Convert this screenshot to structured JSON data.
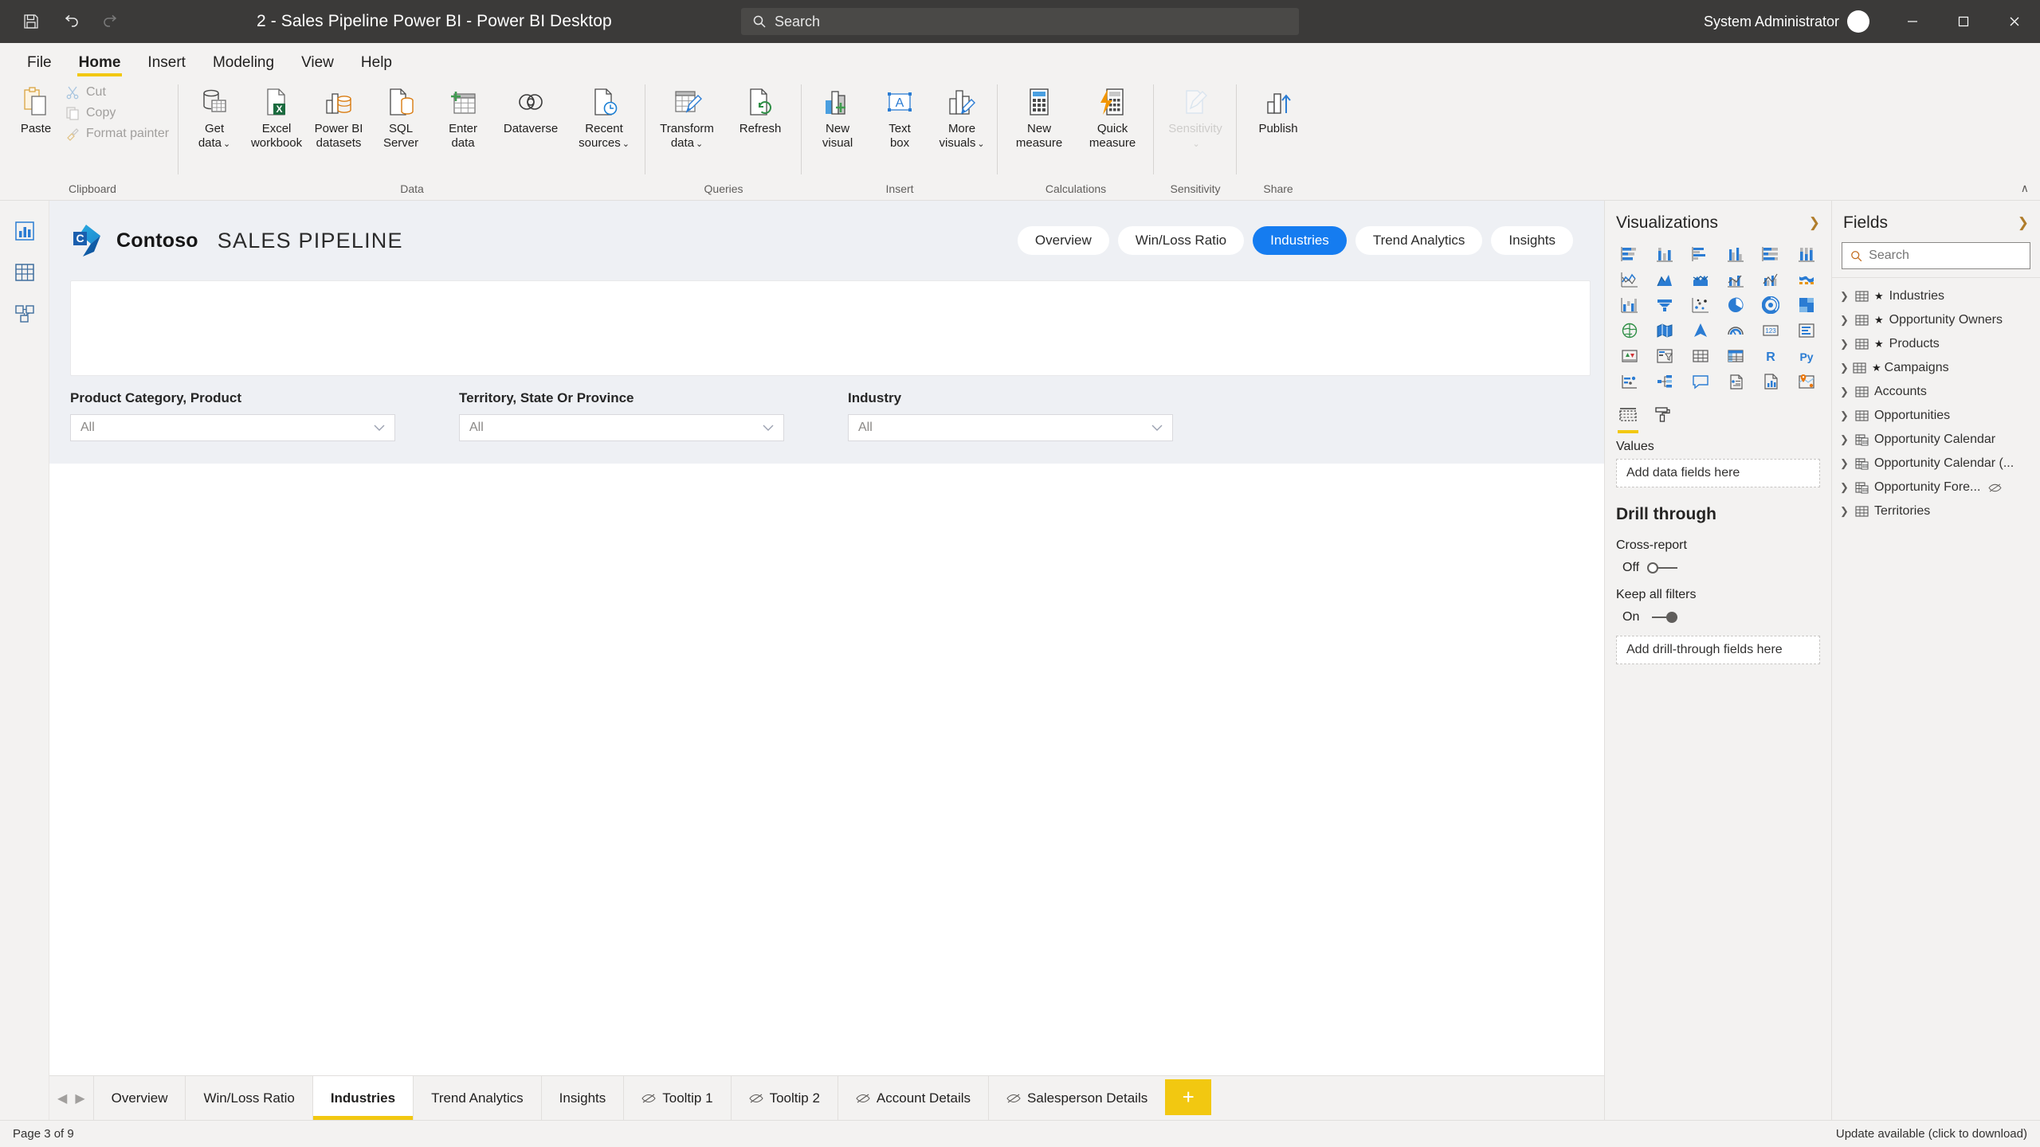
{
  "titlebar": {
    "document_title": "2 - Sales Pipeline Power BI - Power BI Desktop",
    "search_placeholder": "Search",
    "user": "System Administrator",
    "save_icon": "save-icon",
    "undo_icon": "undo-icon",
    "redo_icon": "redo-icon",
    "minimize_icon": "minimize-icon",
    "maximize_icon": "maximize-icon",
    "close_icon": "close-icon"
  },
  "ribbon": {
    "tabs": [
      {
        "label": "File",
        "active": false
      },
      {
        "label": "Home",
        "active": true
      },
      {
        "label": "Insert",
        "active": false
      },
      {
        "label": "Modeling",
        "active": false
      },
      {
        "label": "View",
        "active": false
      },
      {
        "label": "Help",
        "active": false
      }
    ],
    "groups": [
      {
        "name": "Clipboard",
        "paste_label": "Paste",
        "small_items": [
          {
            "label": "Cut",
            "icon": "scissors-icon"
          },
          {
            "label": "Copy",
            "icon": "copy-icon"
          },
          {
            "label": "Format painter",
            "icon": "paintbrush-icon"
          }
        ]
      },
      {
        "name": "Data",
        "buttons": [
          {
            "label_1": "Get",
            "label_2": "data",
            "dropdown": true,
            "icon": "database-table-icon"
          },
          {
            "label_1": "Excel",
            "label_2": "workbook",
            "dropdown": false,
            "icon": "excel-icon"
          },
          {
            "label_1": "Power BI",
            "label_2": "datasets",
            "dropdown": false,
            "icon": "powerbi-dataset-icon"
          },
          {
            "label_1": "SQL",
            "label_2": "Server",
            "dropdown": false,
            "icon": "sql-server-icon"
          },
          {
            "label_1": "Enter",
            "label_2": "data",
            "dropdown": false,
            "icon": "enter-data-icon"
          },
          {
            "label_1": "Dataverse",
            "label_2": "",
            "dropdown": false,
            "icon": "dataverse-icon"
          },
          {
            "label_1": "Recent",
            "label_2": "sources",
            "dropdown": true,
            "icon": "recent-sources-icon"
          }
        ]
      },
      {
        "name": "Queries",
        "buttons": [
          {
            "label_1": "Transform",
            "label_2": "data",
            "dropdown": true,
            "icon": "transform-data-icon"
          },
          {
            "label_1": "Refresh",
            "label_2": "",
            "dropdown": false,
            "icon": "refresh-icon"
          }
        ]
      },
      {
        "name": "Insert",
        "buttons": [
          {
            "label_1": "New",
            "label_2": "visual",
            "dropdown": false,
            "icon": "new-visual-icon"
          },
          {
            "label_1": "Text",
            "label_2": "box",
            "dropdown": false,
            "icon": "text-box-icon"
          },
          {
            "label_1": "More",
            "label_2": "visuals",
            "dropdown": true,
            "icon": "more-visuals-icon"
          }
        ]
      },
      {
        "name": "Calculations",
        "buttons": [
          {
            "label_1": "New",
            "label_2": "measure",
            "dropdown": false,
            "icon": "new-measure-icon"
          },
          {
            "label_1": "Quick",
            "label_2": "measure",
            "dropdown": false,
            "icon": "quick-measure-icon"
          }
        ]
      },
      {
        "name": "Sensitivity",
        "buttons": [
          {
            "label_1": "Sensitivity",
            "label_2": "",
            "dropdown": true,
            "icon": "sensitivity-icon",
            "disabled": true
          }
        ]
      },
      {
        "name": "Share",
        "buttons": [
          {
            "label_1": "Publish",
            "label_2": "",
            "dropdown": false,
            "icon": "publish-icon"
          }
        ]
      }
    ],
    "collapse_label": "∧"
  },
  "view_rail": [
    {
      "name": "report-view",
      "icon": "report-chart-icon",
      "active": true
    },
    {
      "name": "data-view",
      "icon": "data-table-icon",
      "active": false
    },
    {
      "name": "model-view",
      "icon": "model-relationship-icon",
      "active": false
    }
  ],
  "report": {
    "brand": "Contoso",
    "subtitle": "SALES PIPELINE",
    "logo_letter": "C",
    "nav_pills": [
      {
        "label": "Overview",
        "active": false
      },
      {
        "label": "Win/Loss Ratio",
        "active": false
      },
      {
        "label": "Industries",
        "active": true
      },
      {
        "label": "Trend Analytics",
        "active": false
      },
      {
        "label": "Insights",
        "active": false
      }
    ],
    "accent_color": "#157cf0",
    "slicers": [
      {
        "title": "Product Category, Product",
        "value": "All"
      },
      {
        "title": "Territory, State Or Province",
        "value": "All"
      },
      {
        "title": "Industry",
        "value": "All"
      }
    ]
  },
  "page_tabs": {
    "prev_icon": "chevron-left-icon",
    "next_icon": "chevron-right-icon",
    "items": [
      {
        "label": "Overview",
        "active": false,
        "hidden": false
      },
      {
        "label": "Win/Loss Ratio",
        "active": false,
        "hidden": false
      },
      {
        "label": "Industries",
        "active": true,
        "hidden": false
      },
      {
        "label": "Trend Analytics",
        "active": false,
        "hidden": false
      },
      {
        "label": "Insights",
        "active": false,
        "hidden": false
      },
      {
        "label": "Tooltip 1",
        "active": false,
        "hidden": true
      },
      {
        "label": "Tooltip 2",
        "active": false,
        "hidden": true
      },
      {
        "label": "Account Details",
        "active": false,
        "hidden": true
      },
      {
        "label": "Salesperson Details",
        "active": false,
        "hidden": true
      }
    ],
    "add_label": "+"
  },
  "visualizations": {
    "title": "Visualizations",
    "expand_icon": "chevron-right-icon",
    "icons": [
      "stacked-bar-chart-icon",
      "stacked-column-chart-icon",
      "clustered-bar-chart-icon",
      "clustered-column-chart-icon",
      "100-stacked-bar-chart-icon",
      "100-stacked-column-chart-icon",
      "line-chart-icon",
      "area-chart-icon",
      "stacked-area-chart-icon",
      "line-stacked-column-chart-icon",
      "line-clustered-column-chart-icon",
      "ribbon-chart-icon",
      "waterfall-chart-icon",
      "funnel-chart-icon",
      "scatter-chart-icon",
      "pie-chart-icon",
      "donut-chart-icon",
      "treemap-icon",
      "map-icon",
      "filled-map-icon",
      "azure-map-icon",
      "gauge-icon",
      "card-icon",
      "multi-row-card-icon",
      "kpi-icon",
      "slicer-icon",
      "table-icon",
      "matrix-icon",
      "r-script-visual-icon",
      "python-visual-icon",
      "key-influencers-icon",
      "decomposition-tree-icon",
      "qna-icon",
      "smart-narrative-icon",
      "paginated-report-icon",
      "arcgis-map-icon"
    ],
    "panel_tabs": [
      {
        "name": "fields-tab",
        "icon": "fields-well-icon",
        "active": true
      },
      {
        "name": "format-tab",
        "icon": "paint-roller-icon",
        "active": false
      }
    ],
    "values_label": "Values",
    "values_placeholder": "Add data fields here",
    "drill_through": {
      "title": "Drill through",
      "cross_report_label": "Cross-report",
      "cross_report_state": "Off",
      "keep_filters_label": "Keep all filters",
      "keep_filters_state": "On",
      "placeholder": "Add drill-through fields here"
    }
  },
  "fields": {
    "title": "Fields",
    "expand_icon": "chevron-right-icon",
    "search_placeholder": "Search",
    "search_icon": "search-icon",
    "items": [
      {
        "label": "Industries",
        "starred": true,
        "icon": "table-icon",
        "hidden": false
      },
      {
        "label": "Opportunity Owners",
        "starred": true,
        "icon": "table-icon",
        "hidden": false
      },
      {
        "label": "Products",
        "starred": true,
        "icon": "table-icon",
        "hidden": false
      },
      {
        "label": "Campaigns",
        "starred": true,
        "icon": "table-icon",
        "hidden": false,
        "tight": true
      },
      {
        "label": "Accounts",
        "starred": false,
        "icon": "table-icon",
        "hidden": false
      },
      {
        "label": "Opportunities",
        "starred": false,
        "icon": "table-icon",
        "hidden": false
      },
      {
        "label": "Opportunity Calendar",
        "starred": false,
        "icon": "calendar-table-icon",
        "hidden": false
      },
      {
        "label": "Opportunity Calendar (...",
        "starred": false,
        "icon": "calendar-table-icon",
        "hidden": false
      },
      {
        "label": "Opportunity Fore...",
        "starred": false,
        "icon": "calendar-table-icon",
        "hidden": true
      },
      {
        "label": "Territories",
        "starred": false,
        "icon": "table-icon",
        "hidden": false
      }
    ]
  },
  "statusbar": {
    "page_indicator": "Page 3 of 9",
    "update_text": "Update available (click to download)"
  }
}
